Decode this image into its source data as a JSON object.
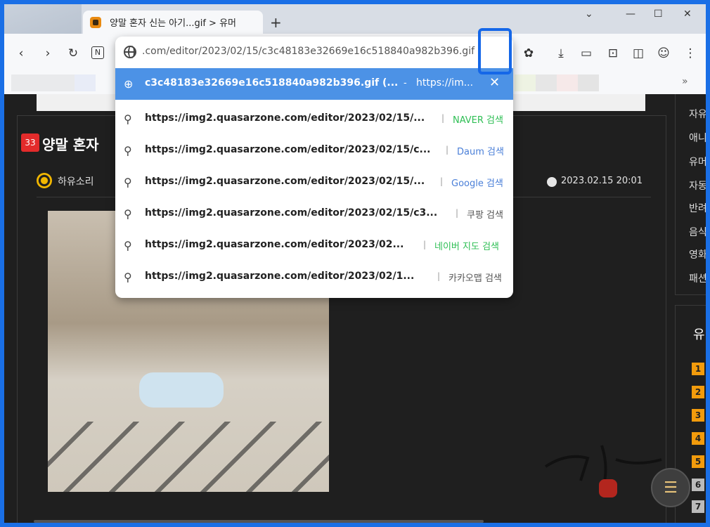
{
  "browser": {
    "tab_title": "양말 혼자 신는 아기...gif > 유머",
    "new_tab_symbol": "+",
    "controls": {
      "dropdown": "⌄",
      "minimize": "—",
      "maximize": "☐",
      "close": "✕"
    },
    "bookmarks_more": "»"
  },
  "omnibox": {
    "url": ".com/editor/2023/02/15/c3c48183e32669e16c518840a982b396.gif",
    "selected": {
      "text": "c3c48183e32669e16c518840a982b396.gif (...",
      "separator": "-",
      "link": "https://im...",
      "close": "✕"
    },
    "suggestions": [
      {
        "url": "https://img2.quasarzone.com/editor/2023/02/15/...",
        "engine": "NAVER 검색",
        "color": "#2fbf55"
      },
      {
        "url": "https://img2.quasarzone.com/editor/2023/02/15/c...",
        "engine": "Daum 검색",
        "color": "#4a7fd8"
      },
      {
        "url": "https://img2.quasarzone.com/editor/2023/02/15/...",
        "engine": "Google 검색",
        "color": "#4a7fd8"
      },
      {
        "url": "https://img2.quasarzone.com/editor/2023/02/15/c3...",
        "engine": "쿠팡 검색",
        "color": "#555555"
      },
      {
        "url": "https://img2.quasarzone.com/editor/2023/02...",
        "engine": "네이버 지도 검색",
        "color": "#2fbf55"
      },
      {
        "url": "https://img2.quasarzone.com/editor/2023/02/1...",
        "engine": "카카오맵 검색",
        "color": "#555555"
      }
    ]
  },
  "post": {
    "badge": "33",
    "title": "양말 혼자",
    "author": "하유소리",
    "date": "2023.02.15 20:01"
  },
  "sidebar": {
    "links": [
      "자유",
      "애니",
      "유머",
      "자동",
      "반려",
      "음식",
      "영화",
      "패션"
    ],
    "heading": "유",
    "ranks": [
      "1",
      "2",
      "3",
      "4",
      "5",
      "6",
      "7"
    ]
  }
}
